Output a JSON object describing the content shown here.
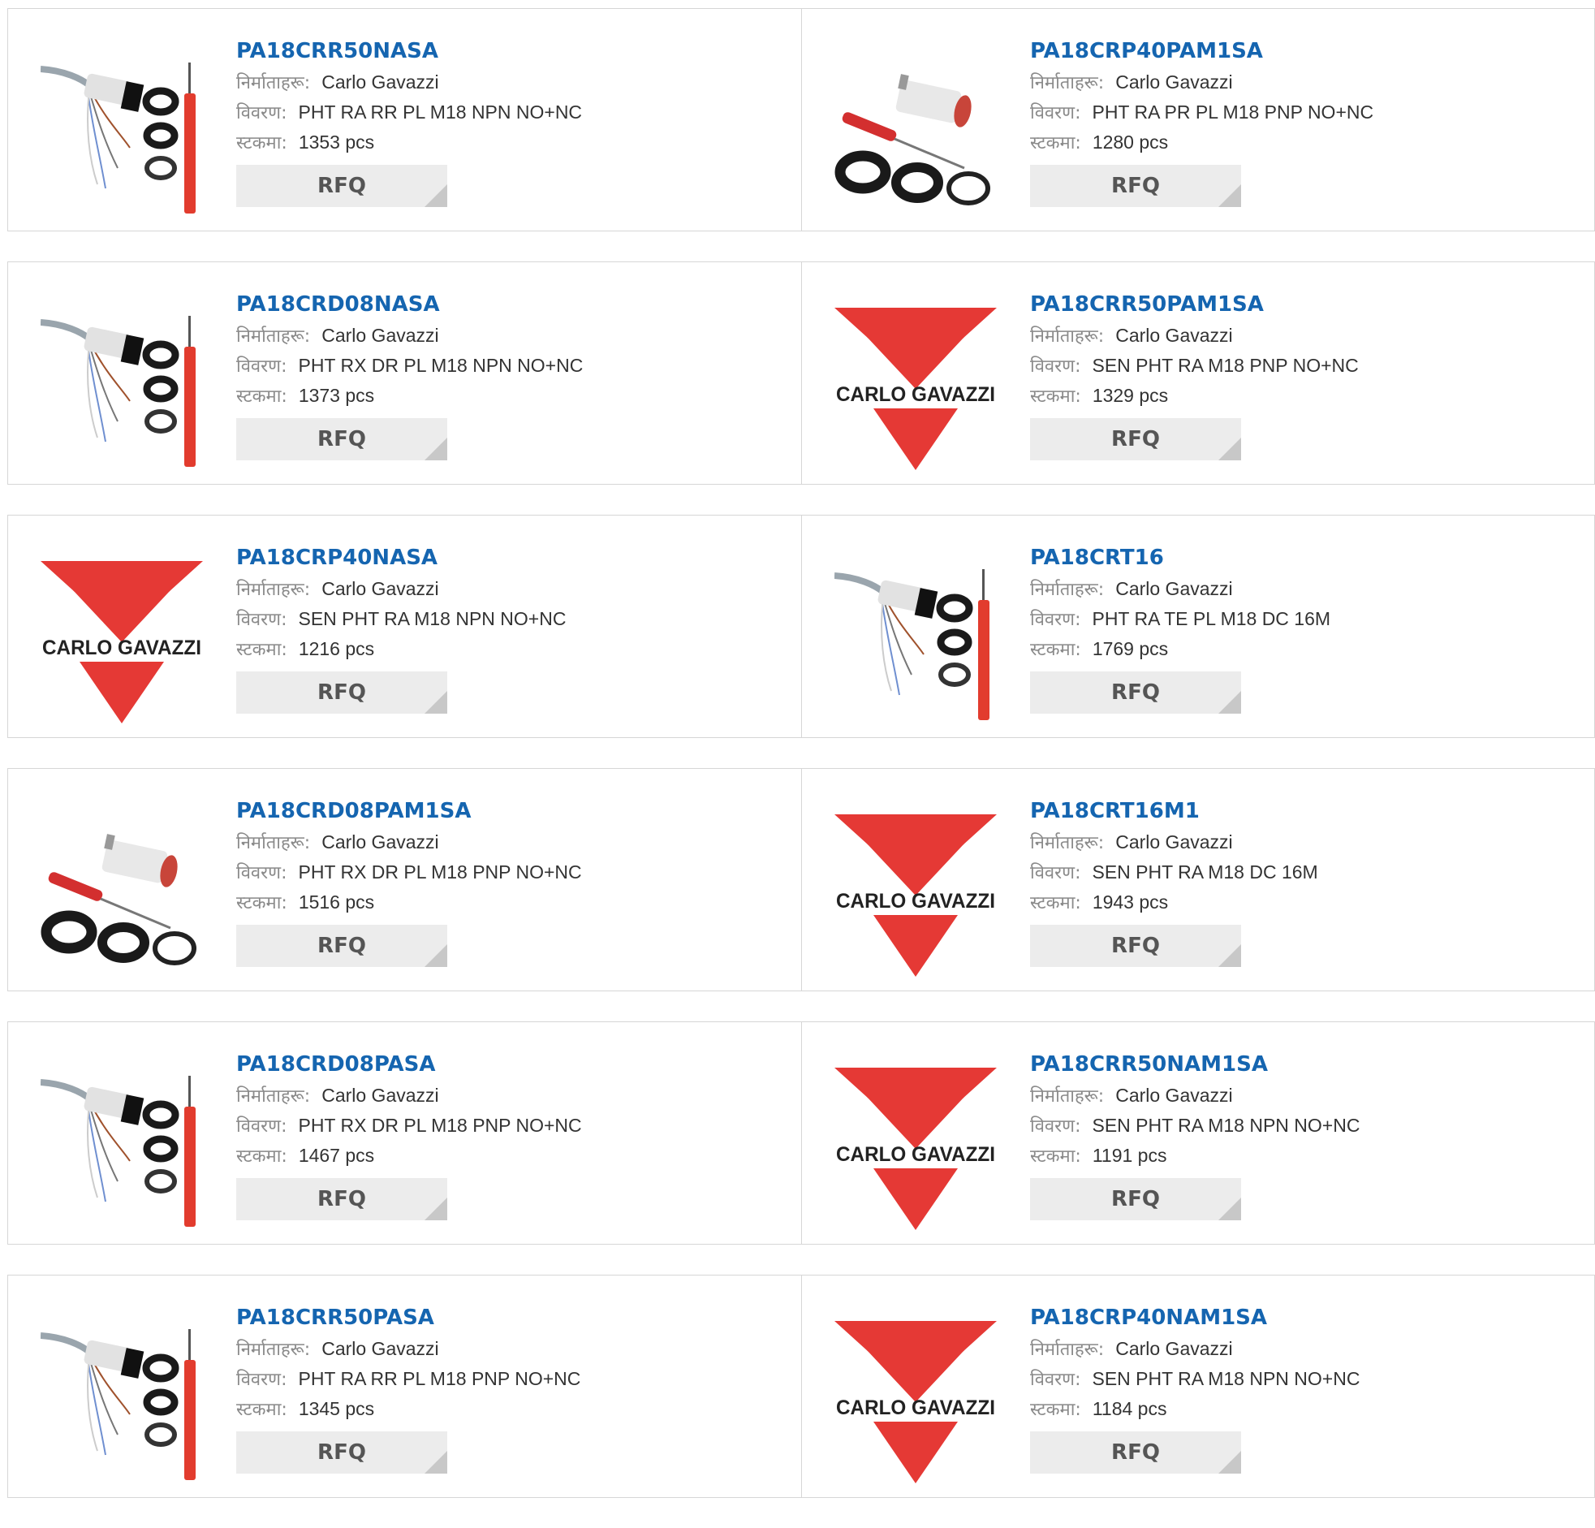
{
  "labels": {
    "manufacturer": "निर्माताहरू:",
    "description": "विवरण:",
    "stock": "स्टकमा:",
    "rfq": "RFQ"
  },
  "brand_logo_text": "CARLO GAVAZZI",
  "colors": {
    "link": "#1565b0",
    "logo_red": "#e53935",
    "rfq_bg": "#ececec"
  },
  "products": [
    {
      "part": "PA18CRR50NASA",
      "manufacturer": "Carlo Gavazzi",
      "description": "PHT RA RR PL M18 NPN NO+NC",
      "stock": "1353 pcs",
      "image": "sensor-cable-kit"
    },
    {
      "part": "PA18CRP40PAM1SA",
      "manufacturer": "Carlo Gavazzi",
      "description": "PHT RA PR PL M18 PNP NO+NC",
      "stock": "1280 pcs",
      "image": "sensor-screwdriver-kit"
    },
    {
      "part": "PA18CRD08NASA",
      "manufacturer": "Carlo Gavazzi",
      "description": "PHT RX DR PL M18 NPN NO+NC",
      "stock": "1373 pcs",
      "image": "sensor-cable-kit"
    },
    {
      "part": "PA18CRR50PAM1SA",
      "manufacturer": "Carlo Gavazzi",
      "description": "SEN PHT RA M18 PNP NO+NC",
      "stock": "1329 pcs",
      "image": "carlo-gavazzi-logo"
    },
    {
      "part": "PA18CRP40NASA",
      "manufacturer": "Carlo Gavazzi",
      "description": "SEN PHT RA M18 NPN NO+NC",
      "stock": "1216 pcs",
      "image": "carlo-gavazzi-logo"
    },
    {
      "part": "PA18CRT16",
      "manufacturer": "Carlo Gavazzi",
      "description": "PHT RA TE PL M18 DC 16M",
      "stock": "1769 pcs",
      "image": "sensor-cable-kit"
    },
    {
      "part": "PA18CRD08PAM1SA",
      "manufacturer": "Carlo Gavazzi",
      "description": "PHT RX DR PL M18 PNP NO+NC",
      "stock": "1516 pcs",
      "image": "sensor-screwdriver-kit"
    },
    {
      "part": "PA18CRT16M1",
      "manufacturer": "Carlo Gavazzi",
      "description": "SEN PHT RA M18 DC 16M",
      "stock": "1943 pcs",
      "image": "carlo-gavazzi-logo"
    },
    {
      "part": "PA18CRD08PASA",
      "manufacturer": "Carlo Gavazzi",
      "description": "PHT RX DR PL M18 PNP NO+NC",
      "stock": "1467 pcs",
      "image": "sensor-cable-kit"
    },
    {
      "part": "PA18CRR50NAM1SA",
      "manufacturer": "Carlo Gavazzi",
      "description": "SEN PHT RA M18 NPN NO+NC",
      "stock": "1191 pcs",
      "image": "carlo-gavazzi-logo"
    },
    {
      "part": "PA18CRR50PASA",
      "manufacturer": "Carlo Gavazzi",
      "description": "PHT RA RR PL M18 PNP NO+NC",
      "stock": "1345 pcs",
      "image": "sensor-cable-kit"
    },
    {
      "part": "PA18CRP40NAM1SA",
      "manufacturer": "Carlo Gavazzi",
      "description": "SEN PHT RA M18 NPN NO+NC",
      "stock": "1184 pcs",
      "image": "carlo-gavazzi-logo"
    }
  ]
}
